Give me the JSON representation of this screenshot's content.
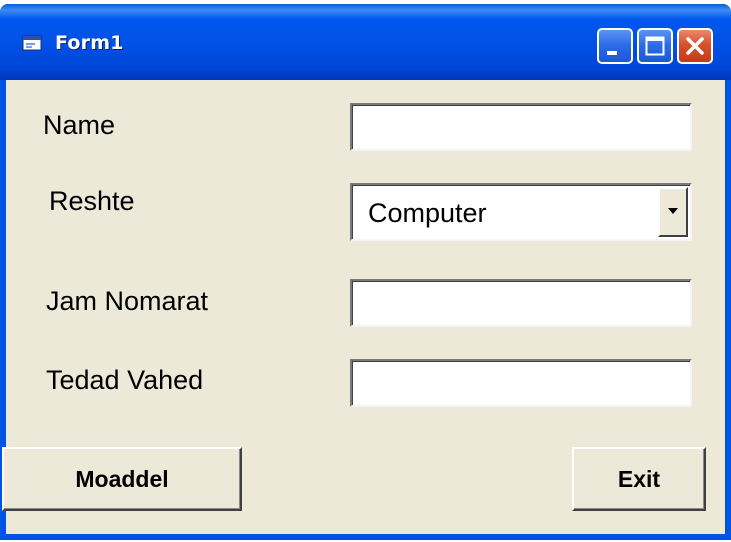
{
  "window": {
    "title": "Form1",
    "icon": "form-icon",
    "controls": {
      "minimize_icon": "minimize-icon",
      "maximize_icon": "maximize-icon",
      "close_icon": "close-icon"
    }
  },
  "form": {
    "name_label": "Name",
    "name_value": "",
    "reshte_label": "Reshte",
    "reshte_selected": "Computer",
    "jam_nomarat_label": "Jam Nomarat",
    "jam_nomarat_value": "",
    "tedad_vahed_label": "Tedad Vahed",
    "tedad_vahed_value": ""
  },
  "buttons": {
    "moaddel_label": "Moaddel",
    "exit_label": "Exit"
  },
  "colors": {
    "titlebar": "#0054e3",
    "client_background": "#ece9d8",
    "close_button": "#d9512c"
  }
}
